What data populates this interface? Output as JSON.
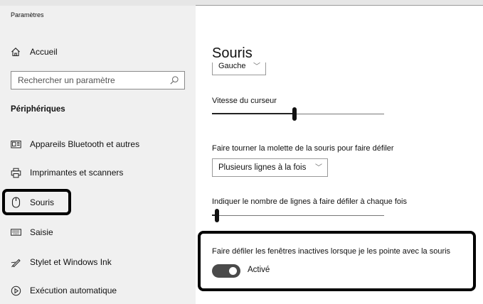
{
  "window": {
    "title": "Paramètres"
  },
  "sidebar": {
    "home_label": "Accueil",
    "search_placeholder": "Rechercher un paramètre",
    "section_heading": "Périphériques",
    "items": [
      {
        "label": "Appareils Bluetooth et autres",
        "icon": "bluetooth-devices-icon"
      },
      {
        "label": "Imprimantes et scanners",
        "icon": "printer-icon"
      },
      {
        "label": "Souris",
        "icon": "mouse-icon",
        "selected": true
      },
      {
        "label": "Saisie",
        "icon": "keyboard-icon"
      },
      {
        "label": "Stylet et Windows Ink",
        "icon": "pen-icon"
      },
      {
        "label": "Exécution automatique",
        "icon": "autoplay-icon"
      }
    ]
  },
  "main": {
    "title": "Souris",
    "primary_button": {
      "value": "Gauche"
    },
    "cursor_speed": {
      "label": "Vitesse du curseur",
      "percent": 48
    },
    "wheel_scroll": {
      "label": "Faire tourner la molette de la souris pour faire défiler",
      "value": "Plusieurs lignes à la fois"
    },
    "lines_to_scroll": {
      "label": "Indiquer le nombre de lignes à faire défiler à chaque fois",
      "percent": 3
    },
    "inactive_scroll": {
      "label": "Faire défiler les fenêtres inactives lorsque je les pointe avec la souris",
      "state": "Activé",
      "on": true
    }
  },
  "colors": {
    "sidebar_bg": "#f0f0f0",
    "toggle_on": "#4a4a4a",
    "highlight_border": "#000000"
  }
}
